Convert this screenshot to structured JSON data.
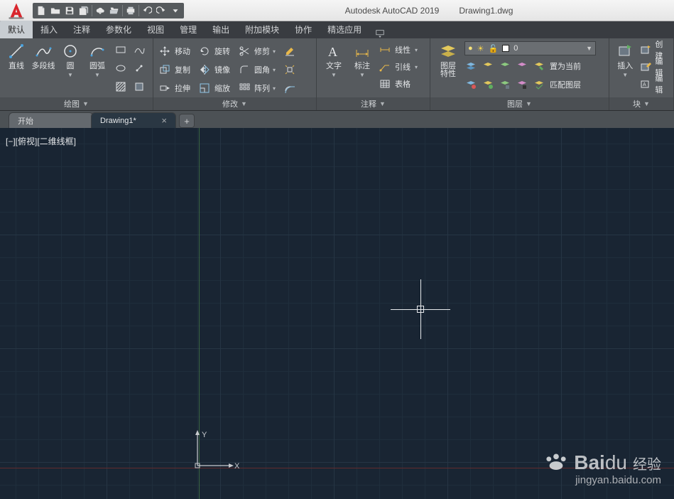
{
  "app": {
    "title": "Autodesk AutoCAD 2019",
    "file": "Drawing1.dwg"
  },
  "quick_access": [
    "new",
    "open",
    "save",
    "saveall",
    "plot",
    "cloud",
    "print",
    "undo",
    "redo"
  ],
  "menu_tabs": [
    "默认",
    "插入",
    "注释",
    "参数化",
    "视图",
    "管理",
    "输出",
    "附加模块",
    "协作",
    "精选应用"
  ],
  "ribbon": {
    "draw": {
      "title": "绘图",
      "tools": {
        "line": "直线",
        "polyline": "多段线",
        "circle": "圆",
        "arc": "圆弧"
      }
    },
    "modify": {
      "title": "修改",
      "items": {
        "move": "移动",
        "rotate": "旋转",
        "trim": "修剪",
        "copy": "复制",
        "mirror": "镜像",
        "fillet": "圆角",
        "stretch": "拉伸",
        "scale": "缩放",
        "array": "阵列"
      }
    },
    "annotate": {
      "title": "注释",
      "text": "文字",
      "dim": "标注",
      "items": {
        "linear": "线性",
        "leader": "引线",
        "table": "表格"
      }
    },
    "layers": {
      "title": "图层",
      "props": "图层\n特性",
      "current_layer": "0",
      "set_current": "置为当前",
      "match": "匹配图层"
    },
    "block": {
      "title": "块",
      "insert": "插入",
      "create": "创建",
      "edit": "编辑",
      "edit2": "编辑"
    }
  },
  "doc_tabs": {
    "start": "开始",
    "drawing": "Drawing1*"
  },
  "viewport_label": "[−][俯视][二维线框]",
  "ucs": {
    "x": "X",
    "y": "Y"
  },
  "watermark": {
    "brand": "Bai",
    "brand2": "du",
    "cn": "经验",
    "url": "jingyan.baidu.com"
  }
}
